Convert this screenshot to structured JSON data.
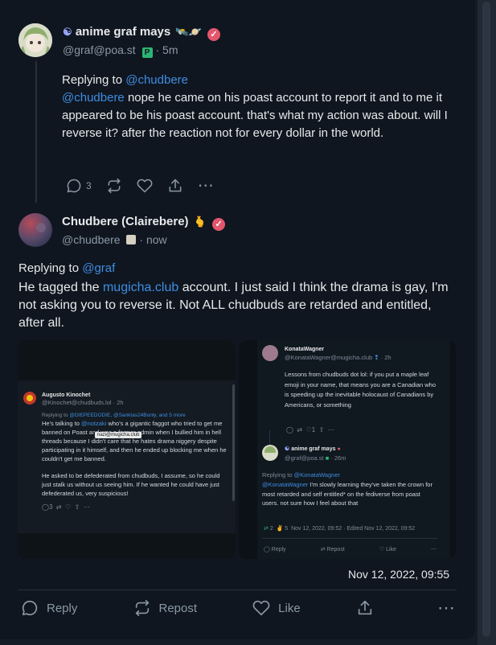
{
  "post1": {
    "display_name": "anime graf mays",
    "name_emoji": "🛰️🪐",
    "handle": "@graf@poa.st",
    "time": "5m",
    "replying_label": "Replying to",
    "replying_to": "@chudbere",
    "mention": "@chudbere",
    "text": " nope he came on his poast account to report it and to me it appeared to be his poast account. that's what my action was about. will I reverse it? after the reaction not for every dollar in the world.",
    "reply_count": "3",
    "colors": {
      "avatar_bg": "#cfd6c4",
      "verified": "#e4566c"
    }
  },
  "post2": {
    "display_name": "Chudbere (Clairebere)",
    "name_emoji": "🫰",
    "handle": "@chudbere",
    "time": "now",
    "replying_label": "Replying to",
    "replying_to": "@graf",
    "text_a": "He tagged the ",
    "text_link": "mugicha.club",
    "text_b": " account. I just said I think the drama is gay, I'm not asking you to reverse it. Not ALL chudbuds are retarded and entitled, after all.",
    "timestamp": "Nov 12, 2022, 09:55",
    "actions": {
      "reply": "Reply",
      "repost": "Repost",
      "like": "Like"
    }
  },
  "image_left": {
    "name": "Augusto Kinochet",
    "handle": "@Kinochet@chudbuds.lol",
    "time": "2h",
    "replying_label": "Replying to",
    "replying_to": "@DIEPEEDODIE, @Sanktas24Bonly, and 5 more",
    "text_1": "He's talking to ",
    "text_1_link": "@notzaki",
    "text_1b": " who's a gigantic faggot who tried to get me banned on Poast and was a former admin when I bullied him in hell threads because I didn't care that he hates drama niggery despite participating in it himself, and then he ended up blocking me when he couldn't get me banned.",
    "tooltip": "nazi@mugicha.club",
    "text_2": "He asked to be defederated from chudbuds, I assume, so he could just stalk us without us seeing him. If he wanted he could have just defederated us, very suspicious!",
    "reply_count": "3"
  },
  "image_right": {
    "p1_name": "KonataWagner",
    "p1_handle": "@KonataWagner@mugicha.club",
    "p1_time": "2h",
    "p1_text": "Lessons from chudbuds dot lol: if you put a maple leaf emoji in your name, that means you are a Canadian who is speeding up the inevitable holocaust of Canadians by Americans, or something",
    "p1_reply_count": "1",
    "p2_name": "anime graf mays",
    "p2_handle": "@graf@poa.st",
    "p2_time": "26m",
    "p2_replying_label": "Replying to",
    "p2_replying_to": "@KonataWagner",
    "p2_mention": "@KonataWagner",
    "p2_text": " I'm slowly learning they've taken the crown for most retarded and self entitled* on the fediverse from poast users. not sure how I feel about that",
    "p2_repost_count": "2",
    "p2_like_count": "5",
    "p2_time_full": "Nov 12, 2022, 09:52 · Edited Nov 12, 2022, 09:52",
    "actions": {
      "reply": "Reply",
      "repost": "Repost",
      "like": "Like"
    }
  }
}
